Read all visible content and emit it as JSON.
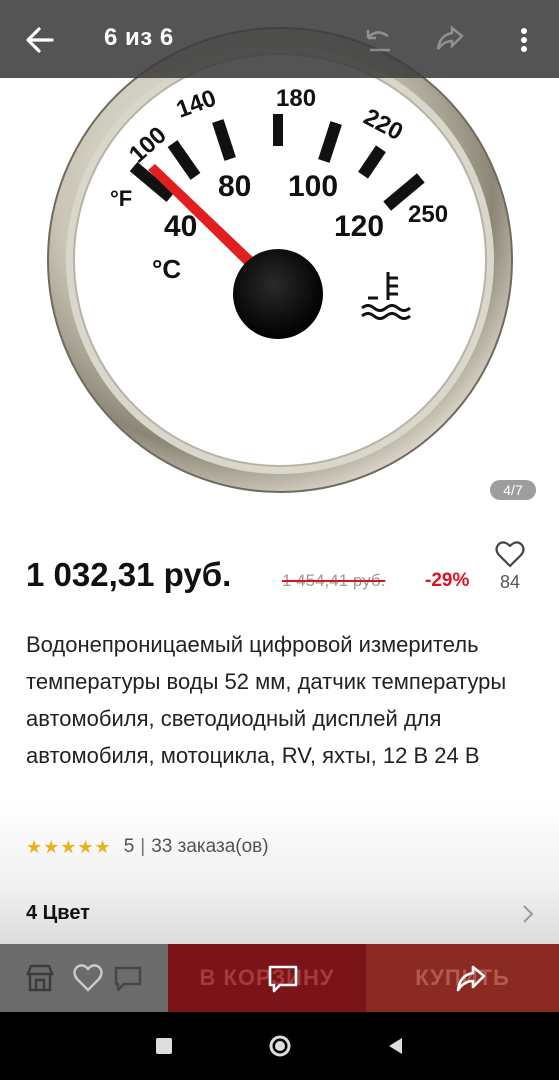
{
  "header": {
    "counter": "6 из 6"
  },
  "image": {
    "page_indicator": "4/7",
    "gauge": {
      "fahrenheit_ticks": [
        "100",
        "140",
        "180",
        "220",
        "250"
      ],
      "celsius_ticks": [
        "40",
        "80",
        "100",
        "120"
      ],
      "unit_f": "°F",
      "unit_c": "°C"
    }
  },
  "product": {
    "price": "1 032,31 руб.",
    "old_price": "1 454,41 руб.",
    "discount": "-29%",
    "favorites_count": "84",
    "title": "Водонепроницаемый цифровой измеритель температуры воды 52 мм, датчик температуры автомобиля, светодиодный дисплей для автомобиля, мотоцикла, RV, яхты, 12 В 24 В",
    "rating": {
      "stars": "★★★★★",
      "score": "5",
      "separator": "|",
      "orders": "33 заказа(ов)"
    }
  },
  "options": {
    "color_label": "4 Цвет"
  },
  "actions": {
    "cart_label": "В КОРЗИНУ",
    "buy_label": "КУПИТЬ"
  },
  "colors": {
    "accent": "#e0101e",
    "star": "#f2b81b"
  },
  "icons": [
    "arrow-left-icon",
    "more-vertical-icon",
    "heart-icon",
    "chevron-right-icon",
    "store-icon",
    "chat-icon",
    "share-icon"
  ]
}
